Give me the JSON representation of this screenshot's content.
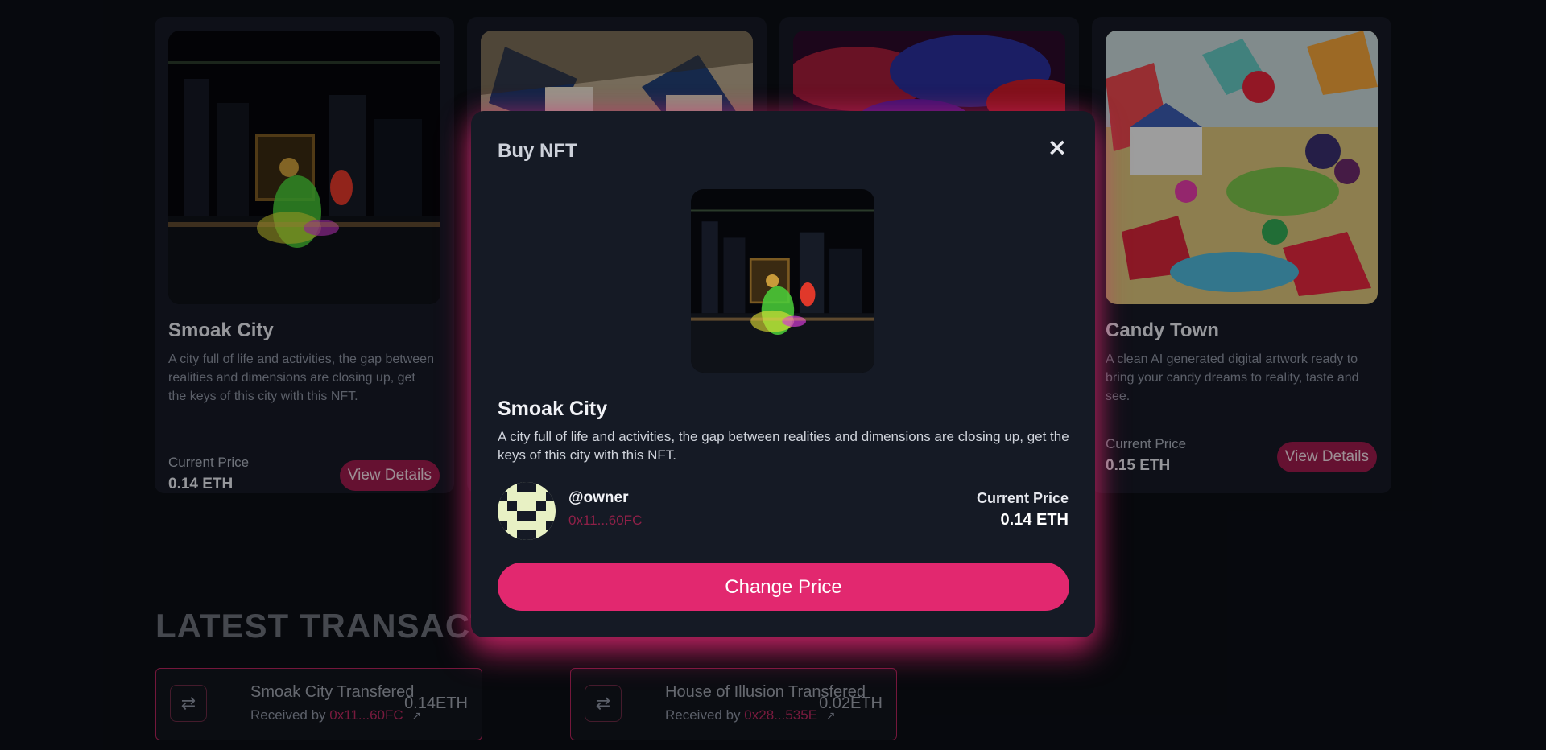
{
  "cards": [
    {
      "title": "Smoak City",
      "description": "A city full of life and activities, the gap between realities and dimensions are closing up, get the keys of this city with this NFT.",
      "price_label": "Current Price",
      "price": "0.14 ETH",
      "button": "View Details"
    },
    {
      "title": "Candy Town",
      "description": "A clean AI generated digital artwork ready to bring your candy dreams to reality, taste and see.",
      "price_label": "Current Price",
      "price": "0.15 ETH",
      "button": "View Details"
    }
  ],
  "section_title": "LATEST TRANSACTIONS",
  "transactions": [
    {
      "icon": "swap-icon",
      "name": "Smoak City Transfered",
      "received_label": "Received by",
      "address": "0x11...60FC",
      "amount": "0.14ETH"
    },
    {
      "icon": "swap-icon",
      "name": "House of Illusion Transfered",
      "received_label": "Received by",
      "address": "0x28...535E",
      "amount": "0.02ETH"
    }
  ],
  "modal": {
    "heading": "Buy NFT",
    "title": "Smoak City",
    "description": "A city full of life and activities, the gap between realities and dimensions are closing up, get the keys of this city with this NFT.",
    "owner": "@owner",
    "owner_address": "0x11...60FC",
    "price_label": "Current Price",
    "price": "0.14 ETH",
    "button": "Change Price"
  },
  "colors": {
    "accent": "#e2286f",
    "background": "#0b0e15",
    "card": "#161a25"
  }
}
